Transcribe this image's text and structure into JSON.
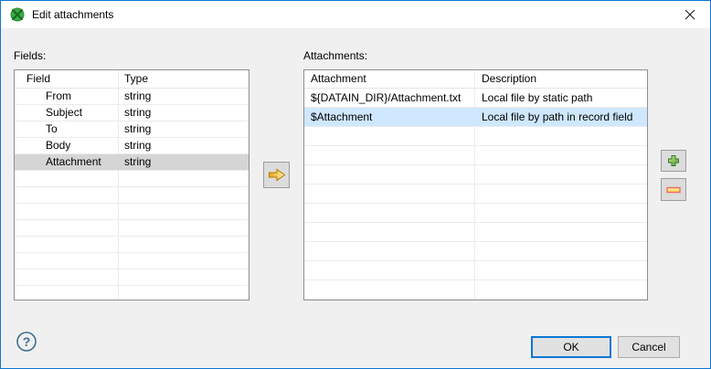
{
  "window": {
    "title": "Edit attachments",
    "close_glyph": "✕"
  },
  "fields_panel": {
    "label": "Fields:",
    "columns": {
      "field": "Field",
      "type": "Type"
    },
    "rows": [
      {
        "field": "From",
        "type": "string",
        "selected": false
      },
      {
        "field": "Subject",
        "type": "string",
        "selected": false
      },
      {
        "field": "To",
        "type": "string",
        "selected": false
      },
      {
        "field": "Body",
        "type": "string",
        "selected": false
      },
      {
        "field": "Attachment",
        "type": "string",
        "selected": true
      }
    ],
    "empty_row_count": 8
  },
  "attachments_panel": {
    "label": "Attachments:",
    "columns": {
      "attachment": "Attachment",
      "description": "Description"
    },
    "rows": [
      {
        "attachment": "${DATAIN_DIR}/Attachment.txt",
        "description": "Local file by static path",
        "selected": false
      },
      {
        "attachment": "$Attachment",
        "description": "Local file by path in record field",
        "selected": true
      }
    ],
    "empty_row_count": 9
  },
  "buttons": {
    "ok": "OK",
    "cancel": "Cancel"
  },
  "icons": {
    "app": "green-clover-component-icon",
    "move": "gold-right-arrow-icon",
    "add": "green-plus-icon",
    "remove": "red-yellow-minus-icon",
    "help": "question-mark-circle-icon"
  },
  "colors": {
    "accent": "#0c76d4",
    "selection_blue": "#cfe8ff",
    "selection_gray": "#d5d5d5",
    "dialog_bg": "#f0f0f0",
    "titlebar_bg": "#ffffff"
  }
}
